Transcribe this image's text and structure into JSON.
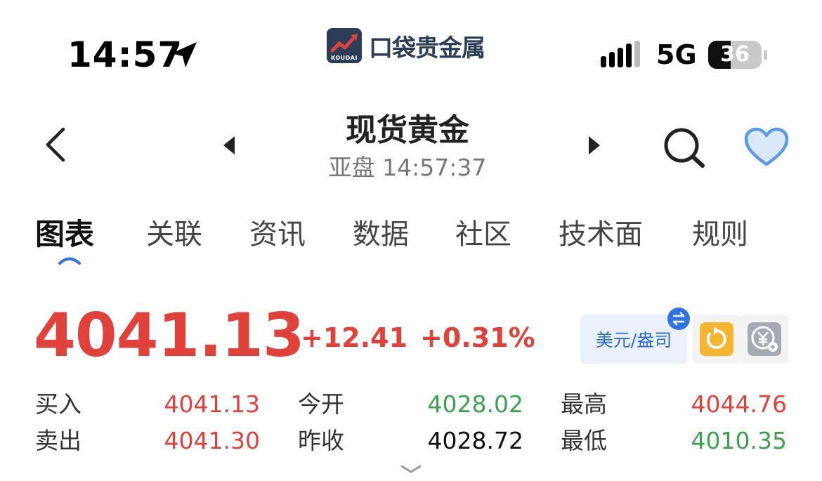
{
  "status_bar": {
    "time": "14:57",
    "brand_name": "口袋贵金属",
    "brand_logo_sub": "KOUDAI",
    "network": "5G",
    "battery": "36"
  },
  "header": {
    "title": "现货黄金",
    "subtitle": "亚盘 14:57:37"
  },
  "tabs": [
    {
      "label": "图表",
      "active": true
    },
    {
      "label": "关联"
    },
    {
      "label": "资讯"
    },
    {
      "label": "数据"
    },
    {
      "label": "社区"
    },
    {
      "label": "技术面"
    },
    {
      "label": "规则"
    }
  ],
  "quote": {
    "price": "4041.13",
    "change": "+12.41",
    "change_pct": "+0.31%",
    "unit_label": "美元/盎司"
  },
  "stats": {
    "buy_label": "买入",
    "buy_value": "4041.13",
    "sell_label": "卖出",
    "sell_value": "4041.30",
    "open_label": "今开",
    "open_value": "4028.02",
    "prev_close_label": "昨收",
    "prev_close_value": "4028.72",
    "high_label": "最高",
    "high_value": "4044.76",
    "low_label": "最低",
    "low_value": "4010.35"
  },
  "colors": {
    "up": "#e0423b",
    "down": "#3ca151",
    "accent": "#2e74e8",
    "heart": "#5a9ae8"
  },
  "icons": [
    "location-arrow-icon",
    "signal-icon",
    "battery-icon",
    "back-icon",
    "prev-icon",
    "next-icon",
    "search-icon",
    "heart-icon",
    "swap-icon",
    "refresh-icon",
    "yuan-exchange-icon",
    "chevron-down-icon"
  ]
}
